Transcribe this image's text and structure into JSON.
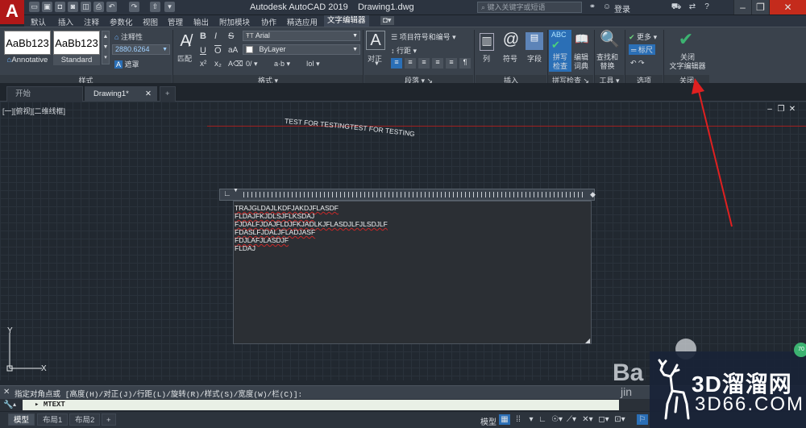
{
  "titlebar": {
    "app_title": "Autodesk AutoCAD 2019",
    "file_title": "Drawing1.dwg",
    "search_placeholder": "键入关键字或短语",
    "login_label": "登录",
    "logo_letter": "A"
  },
  "menu": {
    "items": [
      "默认",
      "插入",
      "注释",
      "参数化",
      "视图",
      "管理",
      "输出",
      "附加模块",
      "协作",
      "精选应用",
      "文字编辑器"
    ],
    "active": "文字编辑器"
  },
  "ribbon": {
    "style_panel": {
      "swatch1": "AaBb123",
      "swatch2": "AaBb123",
      "style1_label": "Annotative",
      "style2_label": "Standard",
      "annotative_label": "注释性",
      "height_value": "2880.6264",
      "mask_label": "遮罩",
      "title": "样式"
    },
    "format_panel": {
      "match_label": "匹配",
      "bold": "B",
      "italic": "I",
      "strike": "S",
      "underline": "U",
      "overline": "O",
      "font_value": "Arial",
      "color_value": "ByLayer",
      "title": "格式"
    },
    "paragraph_panel": {
      "justify_label": "对正",
      "bullets_label": "项目符号和编号",
      "line_spacing_label": "行距",
      "title": "段落"
    },
    "insert_panel": {
      "columns_label": "列",
      "symbol_label": "符号",
      "field_label": "字段",
      "title": "插入"
    },
    "spell_panel": {
      "spell_check_label_1": "拼写",
      "spell_check_label_2": "检查",
      "dictionary_label_1": "编辑",
      "dictionary_label_2": "词典",
      "spell_icon_text": "ABC",
      "title": "拼写检查"
    },
    "tools_panel": {
      "find_label_1": "查找和",
      "find_label_2": "替换",
      "title": "工具"
    },
    "options_panel": {
      "more_label": "更多",
      "ruler_label": "标尺",
      "title": "选项"
    },
    "close_panel": {
      "close_label_1": "关闭",
      "close_label_2": "文字编辑器",
      "title": "关闭"
    }
  },
  "file_tabs": {
    "start": "开始",
    "drawing": "Drawing1*"
  },
  "viewport": {
    "label": "[一][俯视][二维线框]",
    "curved_text": "TEST FOR TESTINGTEST FOR TESTING"
  },
  "mtext": {
    "lines": [
      "TRAJGLDAJLKDFJAKDJFLASDF",
      "FLDAJFKJDLSJFLKSDAJ",
      "FJDALFJDAJFLDJFKJADLKJFLASDJLFJLSDJLF",
      "FDASLFJDALJFLADJASF",
      "FDJLAFJLASDJF",
      "FLDAJ"
    ]
  },
  "command": {
    "history": "指定对角点或 [高度(H)/对正(J)/行距(L)/旋转(R)/样式(S)/宽度(W)/栏(C)]:",
    "current": "MTEXT"
  },
  "status": {
    "model_tab": "模型",
    "layout1": "布局1",
    "layout2": "布局2",
    "model_label": "模型"
  },
  "watermark": {
    "title": "3D溜溜网",
    "subtitle": "3D66.COM",
    "bai": "Ba",
    "jing": "jin"
  },
  "colors": {
    "logo_red": "#b01818",
    "ribbon_bg": "#3a424c",
    "canvas_bg": "#212830",
    "annotation_arrow": "#e02020",
    "close_check_green": "#3cb371"
  }
}
